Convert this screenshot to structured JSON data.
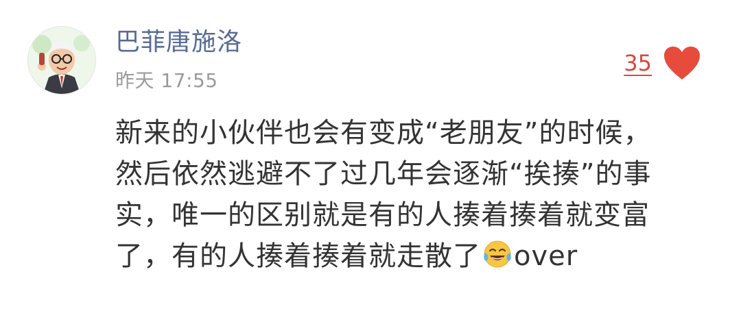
{
  "comment": {
    "author": "巴菲唐施洛",
    "timestamp": "昨天 17:55",
    "likes": "35",
    "icons": {
      "like": "heart-icon",
      "emoji": "laughing-tears-emoji-icon"
    },
    "colors": {
      "author": "#576b95",
      "timestamp": "#9a9a9a",
      "likes": "#d9473b",
      "heart": "#e64b3c",
      "body": "#333333"
    },
    "body_lines": [
      "新来的小伙伴也会有变成“老朋友”的时候，",
      "然后依然逃避不了过几年会逐渐“挨揍”的事",
      "实，唯一的区别就是有的人揍着揍着就变富",
      "了，有的人揍着揍着就走散了"
    ],
    "body_after_emoji": "over"
  }
}
